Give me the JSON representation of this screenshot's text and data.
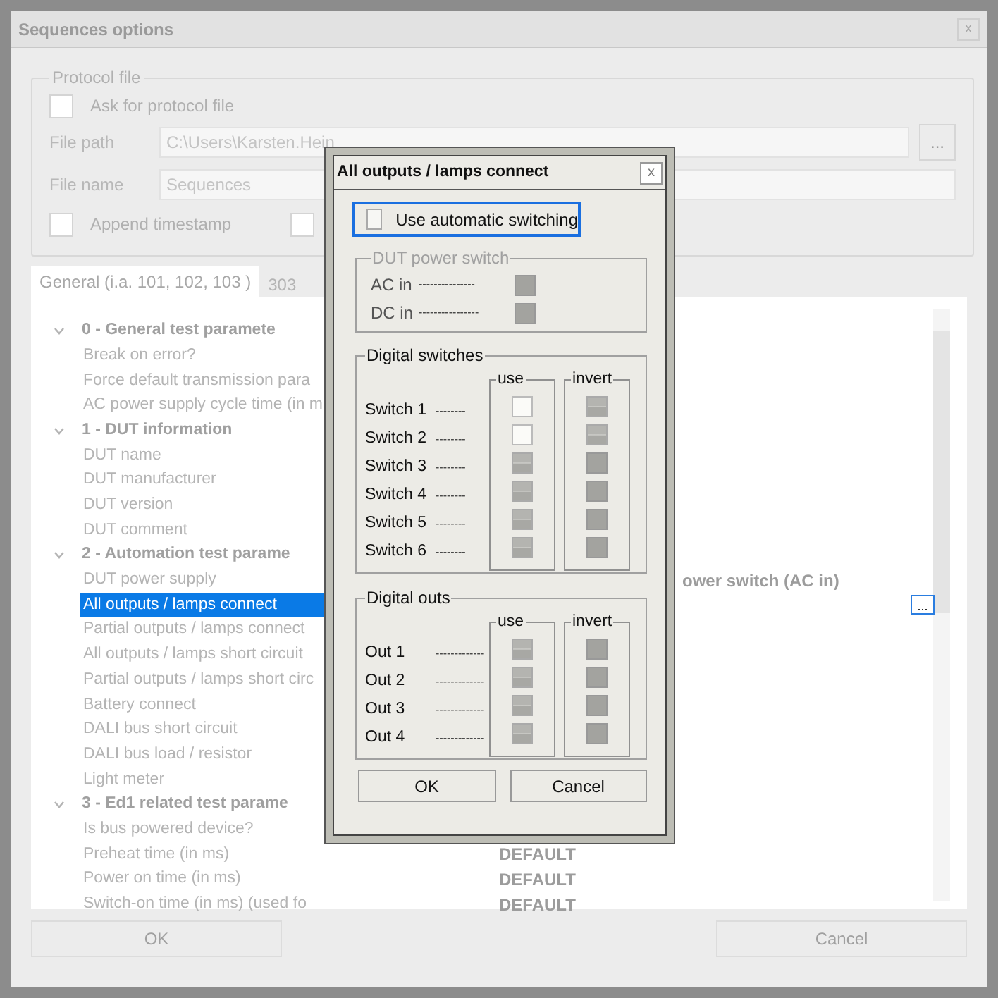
{
  "window": {
    "title": "Sequences options",
    "close": "x"
  },
  "protocol_file": {
    "title": "Protocol file",
    "ask": {
      "label": "Ask for protocol file",
      "checked": false
    },
    "file_path": {
      "label": "File path",
      "value": "C:\\Users\\Karsten.Hein",
      "browse": "..."
    },
    "file_name": {
      "label": "File name",
      "value": "Sequences"
    },
    "append": {
      "label": "Append timestamp",
      "checked": false
    },
    "second_checkbox": {
      "checked": false
    }
  },
  "tabs": [
    {
      "label": "General (i.a. 101, 102, 103 )",
      "selected": true
    },
    {
      "label": "303",
      "selected": false
    }
  ],
  "tree": [
    {
      "label": "0 - General test paramete",
      "expanded": true,
      "children": [
        {
          "label": "Break on error?"
        },
        {
          "label": "Force default transmission para"
        },
        {
          "label": "AC power supply cycle time (in m"
        }
      ]
    },
    {
      "label": "1 - DUT information",
      "expanded": true,
      "children": [
        {
          "label": "DUT name"
        },
        {
          "label": "DUT manufacturer"
        },
        {
          "label": "DUT version"
        },
        {
          "label": "DUT comment"
        }
      ]
    },
    {
      "label": "2 - Automation test parame",
      "expanded": true,
      "children": [
        {
          "label": "DUT power supply",
          "value": "ower switch (AC in)"
        },
        {
          "label": "All outputs / lamps connect",
          "selected": true,
          "button": "..."
        },
        {
          "label": "Partial outputs / lamps connect"
        },
        {
          "label": "All outputs / lamps short circuit"
        },
        {
          "label": "Partial outputs / lamps short circ"
        },
        {
          "label": "Battery connect"
        },
        {
          "label": "DALI bus short circuit"
        },
        {
          "label": "DALI bus load / resistor"
        },
        {
          "label": "Light meter"
        }
      ]
    },
    {
      "label": "3 - Ed1 related test parame",
      "expanded": true,
      "children": [
        {
          "label": "Is bus powered device?"
        },
        {
          "label": "Preheat time (in ms)",
          "value": "DEFAULT"
        },
        {
          "label": "Power on time (in ms)",
          "value": "DEFAULT"
        },
        {
          "label": "Switch-on time (in ms) (used fo",
          "value": "DEFAULT"
        }
      ]
    }
  ],
  "buttons": [
    "OK",
    "Cancel"
  ],
  "dialog": {
    "title": "All outputs / lamps connect",
    "close": "x",
    "auto_switching": {
      "label": "Use automatic switching",
      "checked": false,
      "focused": true
    },
    "dut_power_switch": {
      "title": "DUT power switch",
      "disabled": true,
      "rows": [
        {
          "label": "AC in",
          "dashes": "---------------"
        },
        {
          "label": "DC in",
          "dashes": "----------------"
        }
      ]
    },
    "digital_switches": {
      "title": "Digital switches",
      "use_title": "use",
      "invert_title": "invert",
      "rows": [
        {
          "label": "Switch 1",
          "dashes": "--------",
          "disabled": false
        },
        {
          "label": "Switch 2",
          "dashes": "--------",
          "disabled": false
        },
        {
          "label": "Switch 3",
          "dashes": "--------",
          "disabled": true
        },
        {
          "label": "Switch 4",
          "dashes": "--------",
          "disabled": true
        },
        {
          "label": "Switch 5",
          "dashes": "--------",
          "disabled": true
        },
        {
          "label": "Switch 6",
          "dashes": "--------",
          "disabled": true
        }
      ]
    },
    "digital_outs": {
      "title": "Digital outs",
      "use_title": "use",
      "invert_title": "invert",
      "rows": [
        {
          "label": "Out 1",
          "dashes": "-------------",
          "disabled": true
        },
        {
          "label": "Out 2",
          "dashes": "-------------",
          "disabled": true
        },
        {
          "label": "Out 3",
          "dashes": "-------------",
          "disabled": true
        },
        {
          "label": "Out 4",
          "dashes": "-------------",
          "disabled": true
        }
      ]
    },
    "buttons": [
      "OK",
      "Cancel"
    ]
  }
}
